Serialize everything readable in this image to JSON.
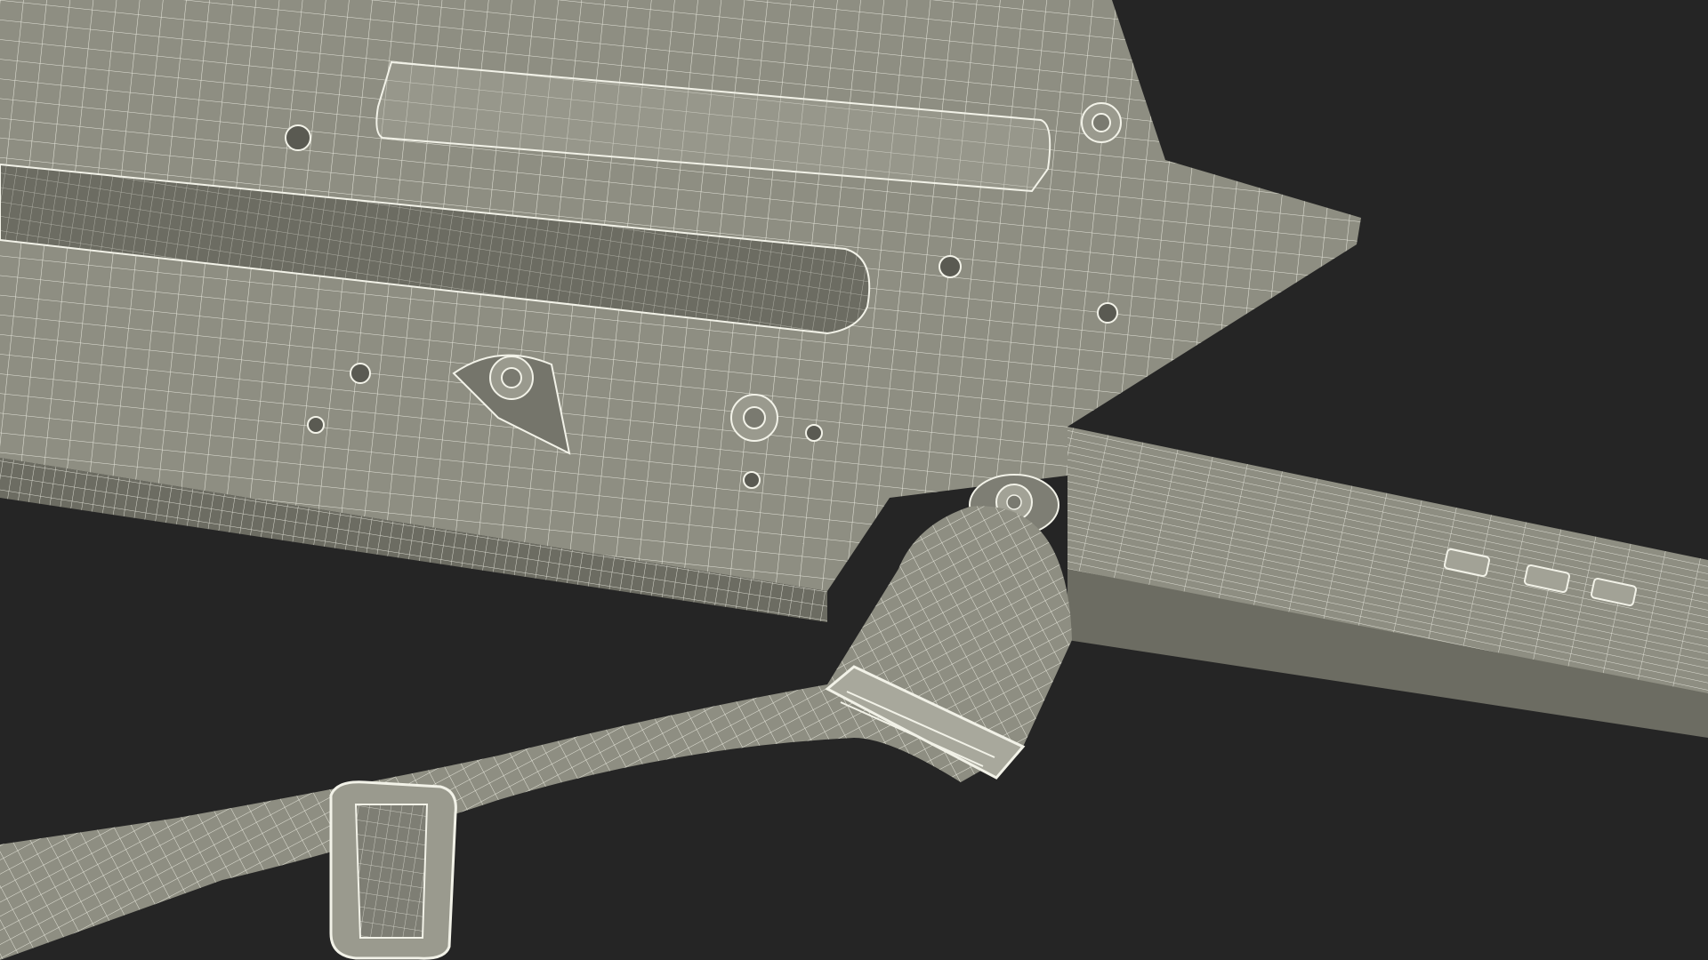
{
  "scene": {
    "background_color": "#252525",
    "surface_color": "#8e8e82",
    "surface_shadow_color": "#6c6c62",
    "wire_color": "#f2f2e8",
    "object_parts": [
      "keytar-body",
      "keytar-neck",
      "strap-button",
      "shoulder-strap",
      "strap-buckle",
      "strap-slider",
      "neck-controls"
    ]
  }
}
